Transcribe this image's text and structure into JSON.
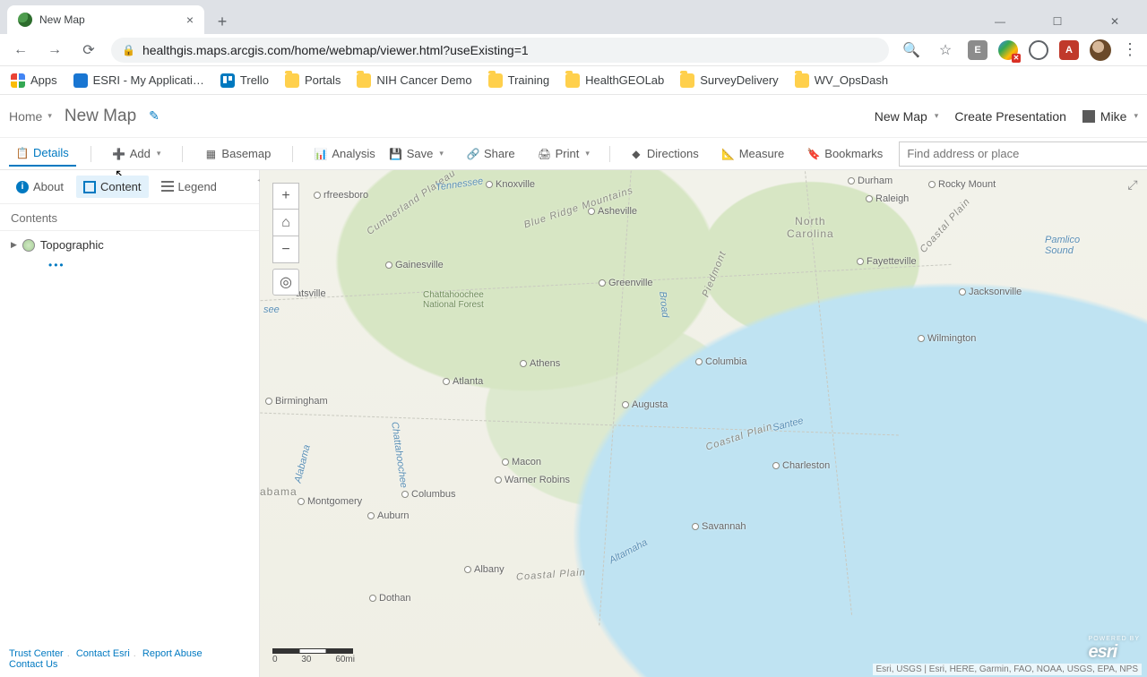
{
  "browser": {
    "tab_title": "New Map",
    "url": "healthgis.maps.arcgis.com/home/webmap/viewer.html?useExisting=1",
    "bookmarks": [
      {
        "label": "Apps",
        "icon": "apps"
      },
      {
        "label": "ESRI - My Applicati…",
        "icon": "circle"
      },
      {
        "label": "Trello",
        "icon": "trello"
      },
      {
        "label": "Portals",
        "icon": "folder"
      },
      {
        "label": "NIH Cancer Demo",
        "icon": "folder"
      },
      {
        "label": "Training",
        "icon": "folder"
      },
      {
        "label": "HealthGEOLab",
        "icon": "folder"
      },
      {
        "label": "SurveyDelivery",
        "icon": "folder"
      },
      {
        "label": "WV_OpsDash",
        "icon": "folder"
      }
    ]
  },
  "header": {
    "home": "Home",
    "title": "New Map",
    "new_map": "New Map",
    "create_presentation": "Create Presentation",
    "user": "Mike"
  },
  "toolbar": {
    "details": "Details",
    "add": "Add",
    "basemap": "Basemap",
    "analysis": "Analysis",
    "save": "Save",
    "share": "Share",
    "print": "Print",
    "directions": "Directions",
    "measure": "Measure",
    "bookmarks": "Bookmarks",
    "search_placeholder": "Find address or place"
  },
  "details_tabs": {
    "about": "About",
    "content": "Content",
    "legend": "Legend"
  },
  "contents": {
    "heading": "Contents",
    "layer": "Topographic"
  },
  "footer": {
    "trust": "Trust Center",
    "contact_esri": "Contact Esri",
    "report": "Report Abuse",
    "contact_us": "Contact Us"
  },
  "map": {
    "scale": {
      "t0": "0",
      "t1": "30",
      "t2": "60mi"
    },
    "attribution": "Esri, USGS | Esri, HERE, Garmin, FAO, NOAA, USGS, EPA, NPS",
    "labels": {
      "knoxville": "Knoxville",
      "freesboro": "rfreesboro",
      "asheville": "Asheville",
      "atsville": "atsville",
      "gainesville": "Gainesville",
      "greenville": "Greenville",
      "athens": "Athens",
      "atlanta": "Atlanta",
      "birmingham": "Birmingham",
      "macon": "Macon",
      "warner": "Warner Robins",
      "columbus": "Columbus",
      "montgomery": "Montgomery",
      "auburn": "Auburn",
      "albany": "Albany",
      "dothan": "Dothan",
      "augusta": "Augusta",
      "columbia": "Columbia",
      "charleston": "Charleston",
      "savannah": "Savannah",
      "durham": "Durham",
      "raleigh": "Raleigh",
      "fayetteville": "Fayetteville",
      "wilmington": "Wilmington",
      "jacksonville": "Jacksonville",
      "rockymount": "Rocky Mount",
      "nc": "North\nCarolina",
      "abama": "abama",
      "cumberland": "Cumberland Plateau",
      "blueridge": "Blue Ridge Mountains",
      "piedmont": "Piedmont",
      "coastal1": "Coastal Plain",
      "coastal2": "Coastal Plain",
      "coastal3": "Coastal Plain",
      "pamlico": "Pamlico\nSound",
      "chatta": "Chattahoochee\nNational Forest",
      "alabama_r": "Alabama",
      "chatt_r": "Chattahoochee",
      "altamaha": "Altamaha",
      "santee": "Santee",
      "broad": "Broad",
      "tenn": "Tennessee",
      "see": "see"
    }
  }
}
